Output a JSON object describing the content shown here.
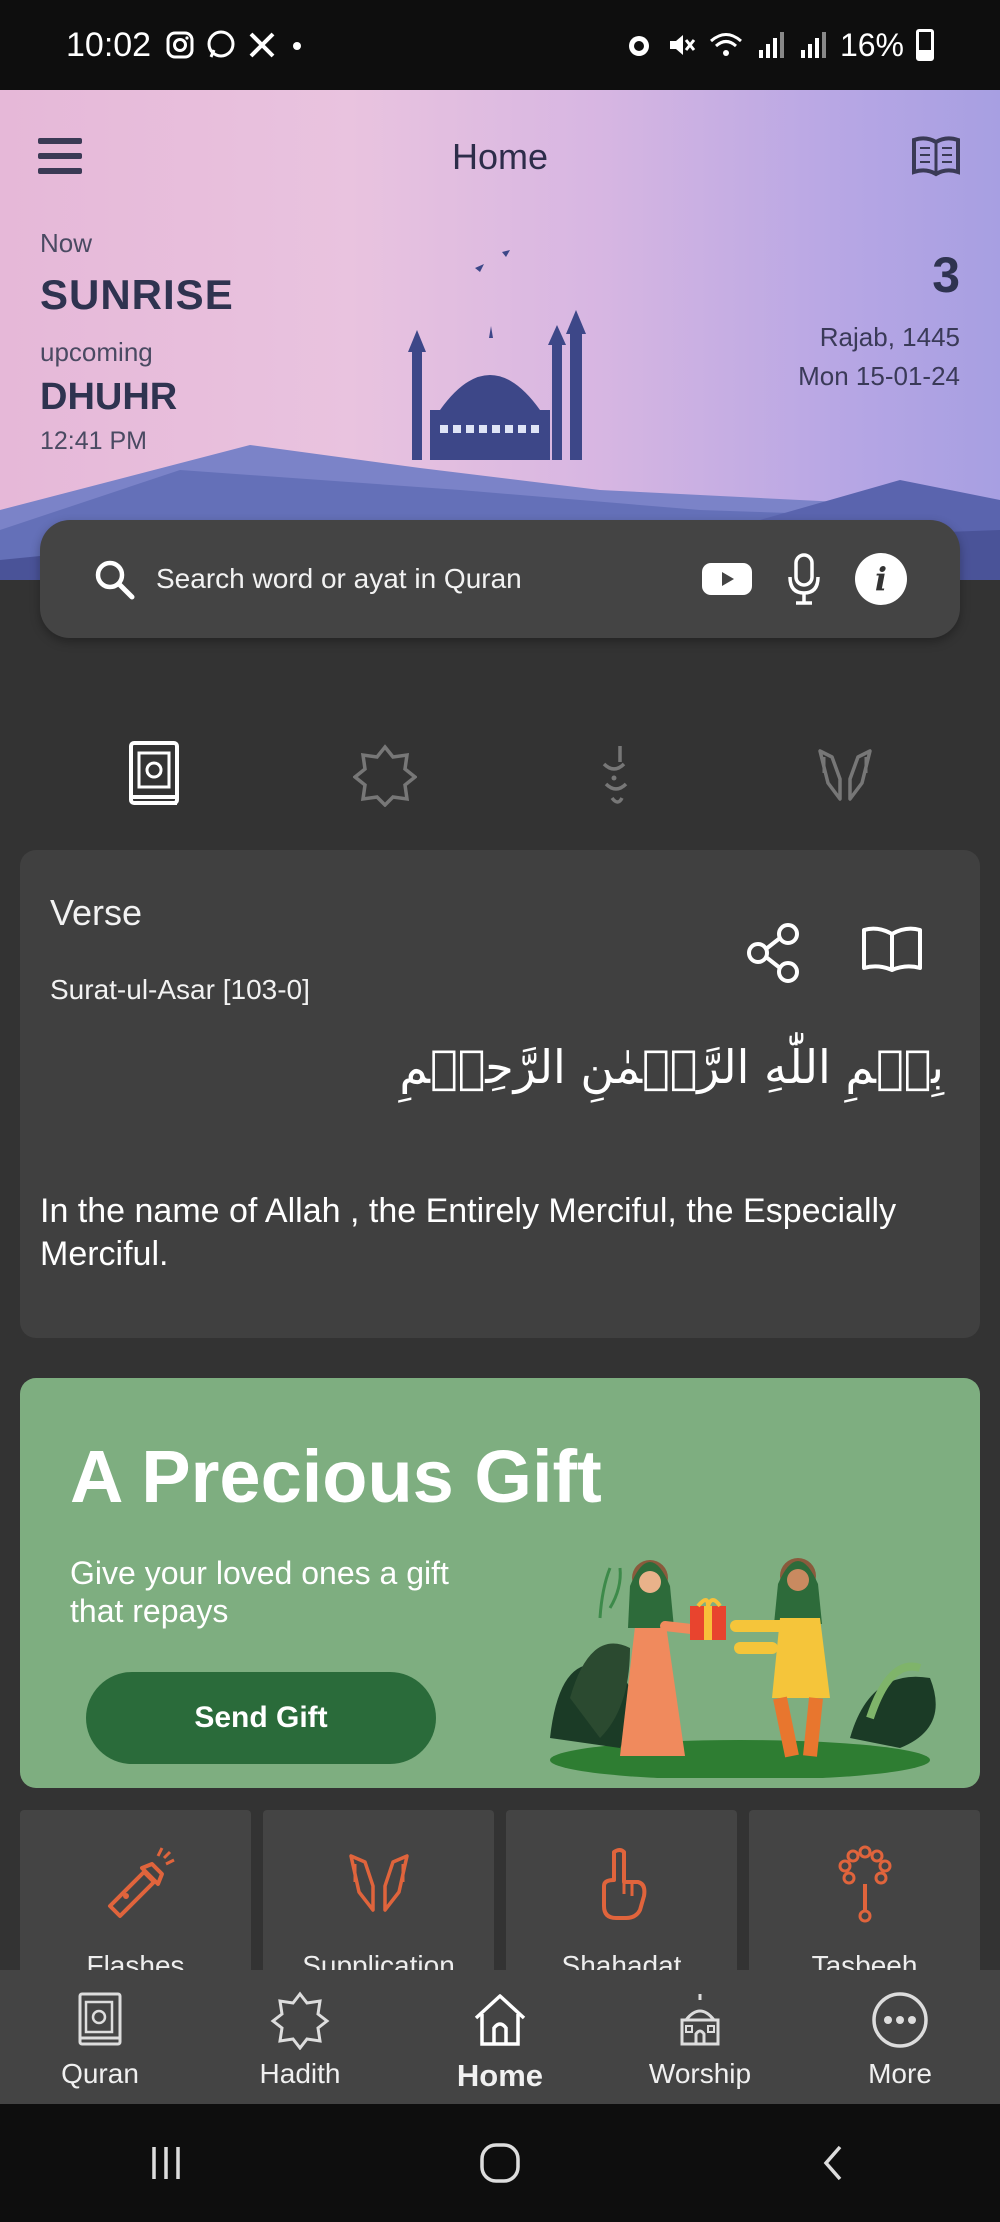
{
  "status_bar": {
    "time": "10:02",
    "battery": "16%",
    "left_icons": [
      "instagram-icon",
      "whatsapp-icon",
      "x-icon",
      "dot-icon"
    ],
    "right_icons": [
      "alarm-icon",
      "mute-icon",
      "wifi-icon",
      "signal-icon",
      "signal-icon",
      "battery-icon"
    ]
  },
  "header": {
    "title": "Home",
    "now_label": "Now",
    "current_prayer": "SUNRISE",
    "upcoming_label": "upcoming",
    "next_prayer": "DHUHR",
    "next_time": "12:41 PM",
    "hijri_day": "3",
    "hijri_month_year": "Rajab, 1445",
    "gregorian_date": "Mon 15-01-24"
  },
  "search": {
    "placeholder": "Search word or ayat in Quran"
  },
  "verse": {
    "label": "Verse",
    "reference": "Surat-ul-Asar [103-0]",
    "arabic": "بِسۡمِ اللّٰهِ الرَّحۡمٰنِ الرَّحِيۡمِ",
    "english": "In the name of Allah , the Entirely Merciful, the Especially Merciful."
  },
  "gift": {
    "title": "A Precious Gift",
    "subtitle": "Give your loved ones a gift that repays",
    "button": "Send Gift"
  },
  "tiles": [
    {
      "label": "Flashes",
      "icon": "flashlight-icon"
    },
    {
      "label": "Supplication",
      "icon": "praying-hands-icon"
    },
    {
      "label": "Shahadat",
      "icon": "raised-finger-icon"
    },
    {
      "label": "Tasbeeh",
      "icon": "prayer-beads-icon"
    }
  ],
  "nav": [
    {
      "label": "Quran",
      "icon": "quran-icon"
    },
    {
      "label": "Hadith",
      "icon": "hadith-icon"
    },
    {
      "label": "Home",
      "icon": "home-icon"
    },
    {
      "label": "Worship",
      "icon": "mosque-icon"
    },
    {
      "label": "More",
      "icon": "more-icon"
    }
  ],
  "colors": {
    "accent_orange": "#e0643c",
    "gift_green": "#7eae80",
    "button_green": "#2a6b3a"
  }
}
